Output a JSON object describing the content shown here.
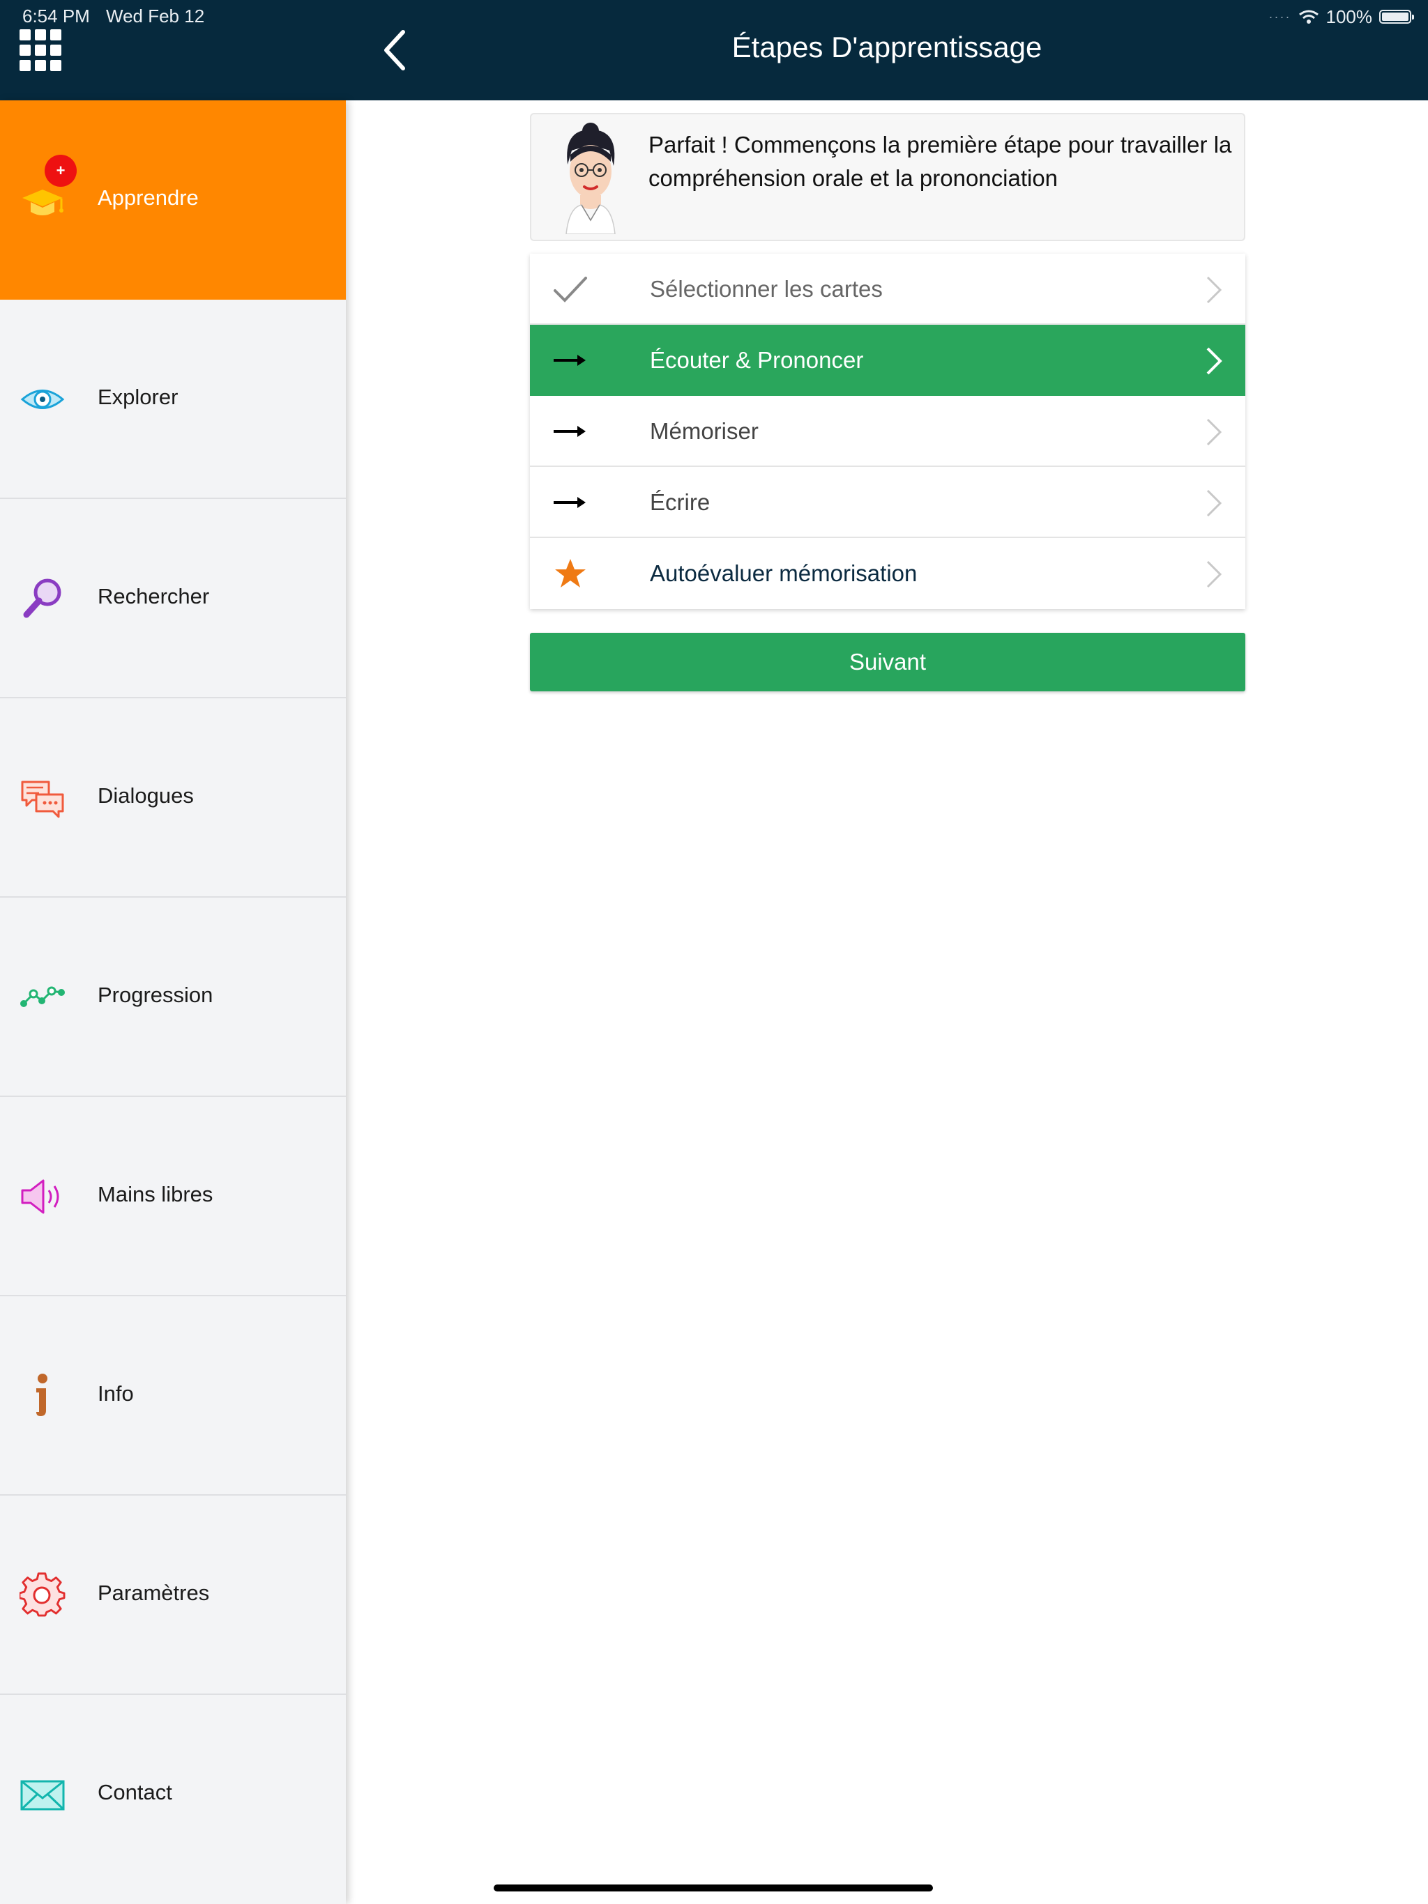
{
  "status_bar": {
    "time": "6:54 PM",
    "date": "Wed Feb 12",
    "battery": "100%"
  },
  "header": {
    "title": "Étapes D'apprentissage",
    "menu_icon": "grid-icon",
    "back_icon": "chevron-left-icon"
  },
  "sidebar": {
    "items": [
      {
        "label": "Apprendre",
        "icon": "graduation-cap-icon",
        "active": true,
        "badge": "+"
      },
      {
        "label": "Explorer",
        "icon": "eye-icon"
      },
      {
        "label": "Rechercher",
        "icon": "magnifier-icon"
      },
      {
        "label": "Dialogues",
        "icon": "chat-bubbles-icon"
      },
      {
        "label": "Progression",
        "icon": "progress-line-icon"
      },
      {
        "label": "Mains libres",
        "icon": "speaker-icon"
      },
      {
        "label": "Info",
        "icon": "info-icon"
      },
      {
        "label": "Paramètres",
        "icon": "gear-icon"
      },
      {
        "label": "Contact",
        "icon": "envelope-icon"
      }
    ]
  },
  "message": {
    "text": "Parfait ! Commençons la première étape pour travailler la compréhension orale et la prononciation"
  },
  "steps": [
    {
      "label": "Sélectionner les cartes",
      "state": "done"
    },
    {
      "label": "Écouter & Prononcer",
      "state": "current"
    },
    {
      "label": "Mémoriser",
      "state": "pending"
    },
    {
      "label": "Écrire",
      "state": "pending"
    },
    {
      "label": "Autoévaluer mémorisation",
      "state": "final"
    }
  ],
  "next_button": {
    "label": "Suivant"
  },
  "colors": {
    "header_bg": "#06293d",
    "active_orange": "#ff8700",
    "green": "#2aa65c",
    "badge_red": "#ee1111",
    "star_orange": "#ef7a14"
  }
}
